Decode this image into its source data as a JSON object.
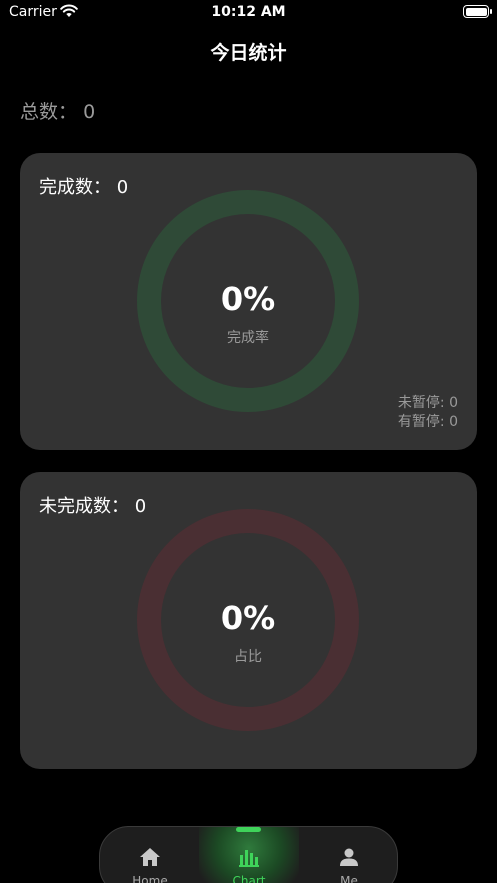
{
  "status_bar": {
    "carrier": "Carrier",
    "time": "10:12 AM"
  },
  "page": {
    "title": "今日统计"
  },
  "summary": {
    "total_label": "总数：",
    "total_value": "0"
  },
  "completed_card": {
    "label": "完成数：",
    "value": "0",
    "percent": "0%",
    "caption": "完成率",
    "ring_color": "#2f4a37",
    "stat_1": "未暂停: 0",
    "stat_2": "有暂停: 0"
  },
  "incomplete_card": {
    "label": "未完成数：",
    "value": "0",
    "percent": "0%",
    "caption": "占比",
    "ring_color": "#4a2f33"
  },
  "tab_bar": {
    "active_color": "#3fd35a",
    "tabs": [
      {
        "label": "Home",
        "icon": "house-icon"
      },
      {
        "label": "Chart",
        "icon": "bar-chart-icon"
      },
      {
        "label": "Me",
        "icon": "person-icon"
      }
    ]
  }
}
